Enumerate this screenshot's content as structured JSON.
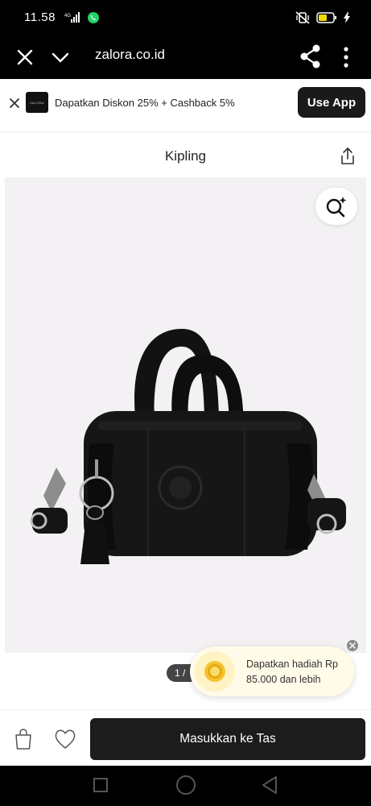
{
  "status_bar": {
    "time": "11.58",
    "network_label": "4G"
  },
  "browser": {
    "url": "zalora.co.id"
  },
  "promo": {
    "logo_text": "ZALORA",
    "text": "Dapatkan Diskon 25% + Cashback 5%",
    "cta": "Use App"
  },
  "product": {
    "brand": "Kipling",
    "image_counter": "1 /"
  },
  "reward": {
    "text": "Dapatkan hadiah Rp 85.000 dan lebih"
  },
  "actions": {
    "add_to_bag": "Masukkan ke Tas"
  },
  "icons": {
    "close": "close-icon",
    "chevron": "chevron-down-icon",
    "share": "share-icon",
    "more": "more-vertical-icon",
    "zoom": "zoom-search-icon",
    "bag": "shopping-bag-icon",
    "heart": "heart-icon"
  },
  "colors": {
    "dark": "#1c1c1c",
    "toast_bg": "#fffbe8",
    "image_bg": "#f3f1f3"
  }
}
